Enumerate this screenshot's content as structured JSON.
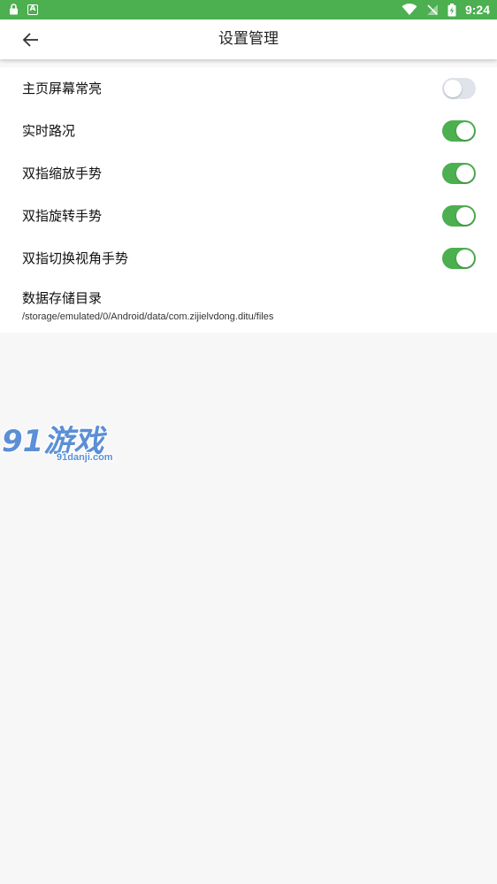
{
  "status_bar": {
    "time": "9:24",
    "left_icons": [
      "lock-icon",
      "a-icon"
    ],
    "right_icons": [
      "wifi-icon",
      "no-sim-icon",
      "battery-charging-icon"
    ]
  },
  "app_bar": {
    "title": "设置管理",
    "back_icon": "arrow-left-icon"
  },
  "settings": {
    "items": [
      {
        "label": "主页屏幕常亮",
        "enabled": false
      },
      {
        "label": "实时路况",
        "enabled": true
      },
      {
        "label": "双指缩放手势",
        "enabled": true
      },
      {
        "label": "双指旋转手势",
        "enabled": true
      },
      {
        "label": "双指切换视角手势",
        "enabled": true
      }
    ],
    "storage": {
      "label": "数据存储目录",
      "path": "/storage/emulated/0/Android/data/com.zijielvdong.ditu/files"
    }
  },
  "watermark": {
    "logo_text": "91游戏",
    "url": "91danji.com"
  },
  "colors": {
    "accent": "#4caf50",
    "toggle_off": "#dfe3ea",
    "background": "#f7f7f7",
    "watermark": "#5b8fd6"
  }
}
